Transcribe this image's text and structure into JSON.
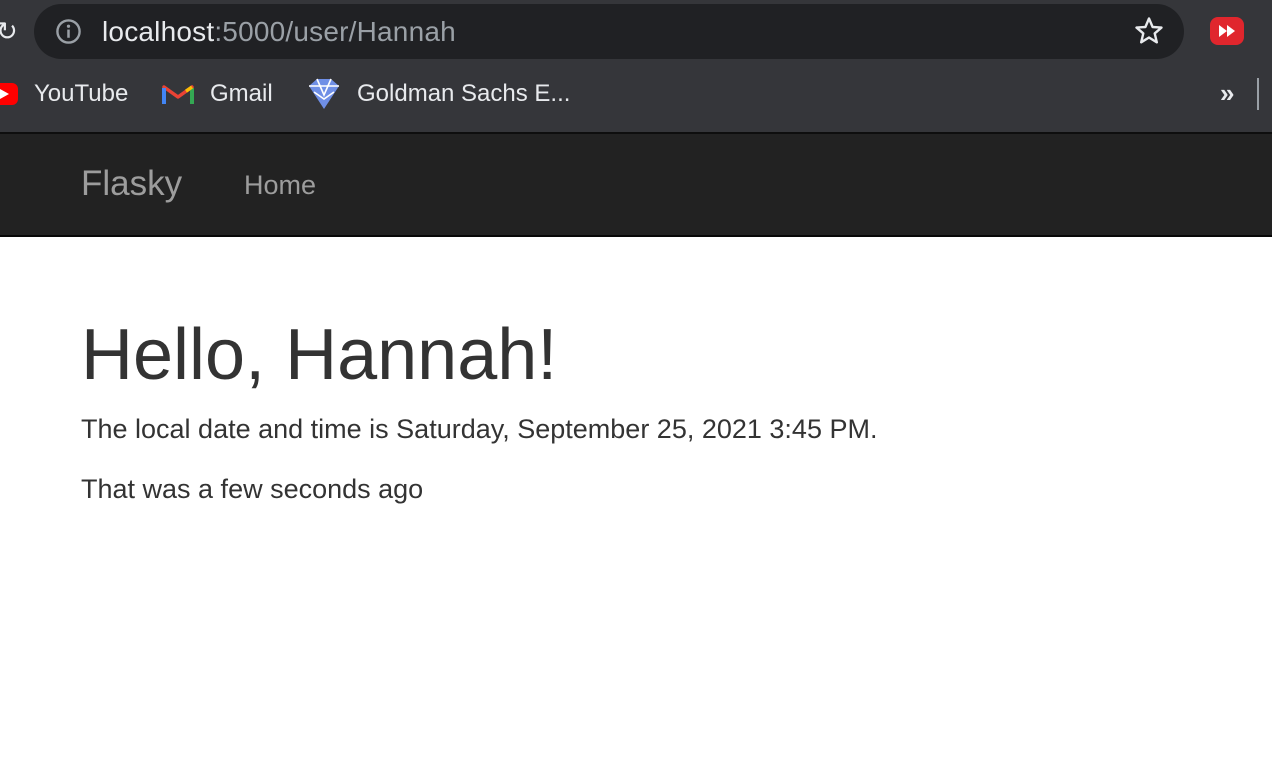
{
  "browser": {
    "url_host": "localhost",
    "url_path": ":5000/user/Hannah",
    "bookmarks": [
      {
        "label": "YouTube",
        "icon": "youtube-icon"
      },
      {
        "label": "Gmail",
        "icon": "gmail-icon"
      },
      {
        "label": "Goldman Sachs E...",
        "icon": "goldman-sachs-icon"
      }
    ],
    "more_label": "»"
  },
  "navbar": {
    "brand": "Flasky",
    "home_label": "Home"
  },
  "page": {
    "greeting": "Hello, Hannah!",
    "datetime_text": "The local date and time is Saturday, September 25, 2021 3:45 PM.",
    "relative_time": "That was a few seconds ago"
  },
  "colors": {
    "chrome_bg": "#35363a",
    "omnibox_bg": "#202124",
    "navbar_bg": "#222222",
    "nav_text": "#9d9d9d",
    "body_text": "#333333"
  }
}
